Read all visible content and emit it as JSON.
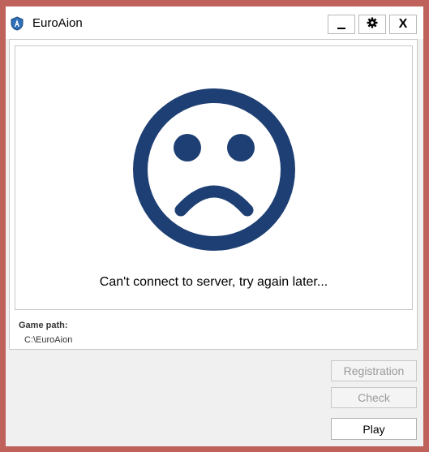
{
  "window": {
    "title": "EuroAion",
    "app_icon": "aion-shield-icon",
    "controls": {
      "minimize_icon": "minimize-icon",
      "settings_icon": "gear-icon",
      "close_label": "X"
    }
  },
  "main": {
    "status_icon": "sad-face-icon",
    "status_message": "Can't connect to server, try again later...",
    "game_path": {
      "label": "Game path:",
      "value": "C:\\EuroAion"
    }
  },
  "actions": {
    "registration_label": "Registration",
    "check_label": "Check",
    "play_label": "Play"
  },
  "colors": {
    "frame": "#c0625c",
    "icon": "#1e3f73",
    "disabled_text": "#9a9a9a"
  }
}
